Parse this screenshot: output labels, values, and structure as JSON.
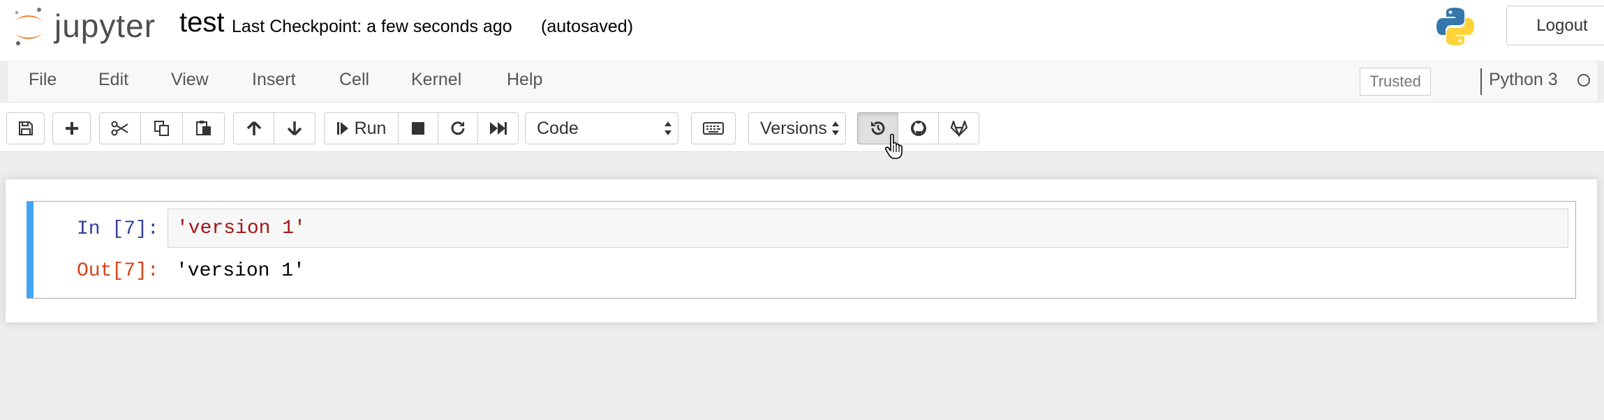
{
  "header": {
    "logo_text": "jupyter",
    "notebook_name": "test",
    "checkpoint": "Last Checkpoint: a few seconds ago",
    "autosave_status": "(autosaved)",
    "logout_label": "Logout"
  },
  "menubar": {
    "items": [
      {
        "label": "File"
      },
      {
        "label": "Edit"
      },
      {
        "label": "View"
      },
      {
        "label": "Insert"
      },
      {
        "label": "Cell"
      },
      {
        "label": "Kernel"
      },
      {
        "label": "Help"
      }
    ],
    "trusted_label": "Trusted",
    "kernel_name": "Python 3"
  },
  "toolbar": {
    "run_label": "Run",
    "cell_type": "Code",
    "versions_label": "Versions"
  },
  "cell": {
    "in_prompt": "In [7]:",
    "source": "'version 1'",
    "out_prompt": "Out[7]:",
    "output": "'version 1'"
  },
  "colors": {
    "cell_selected_bar": "#42a5f5",
    "in_prompt": "#303f9f",
    "out_prompt": "#d84315",
    "string": "#a31515",
    "logo_orange": "#f37726"
  }
}
